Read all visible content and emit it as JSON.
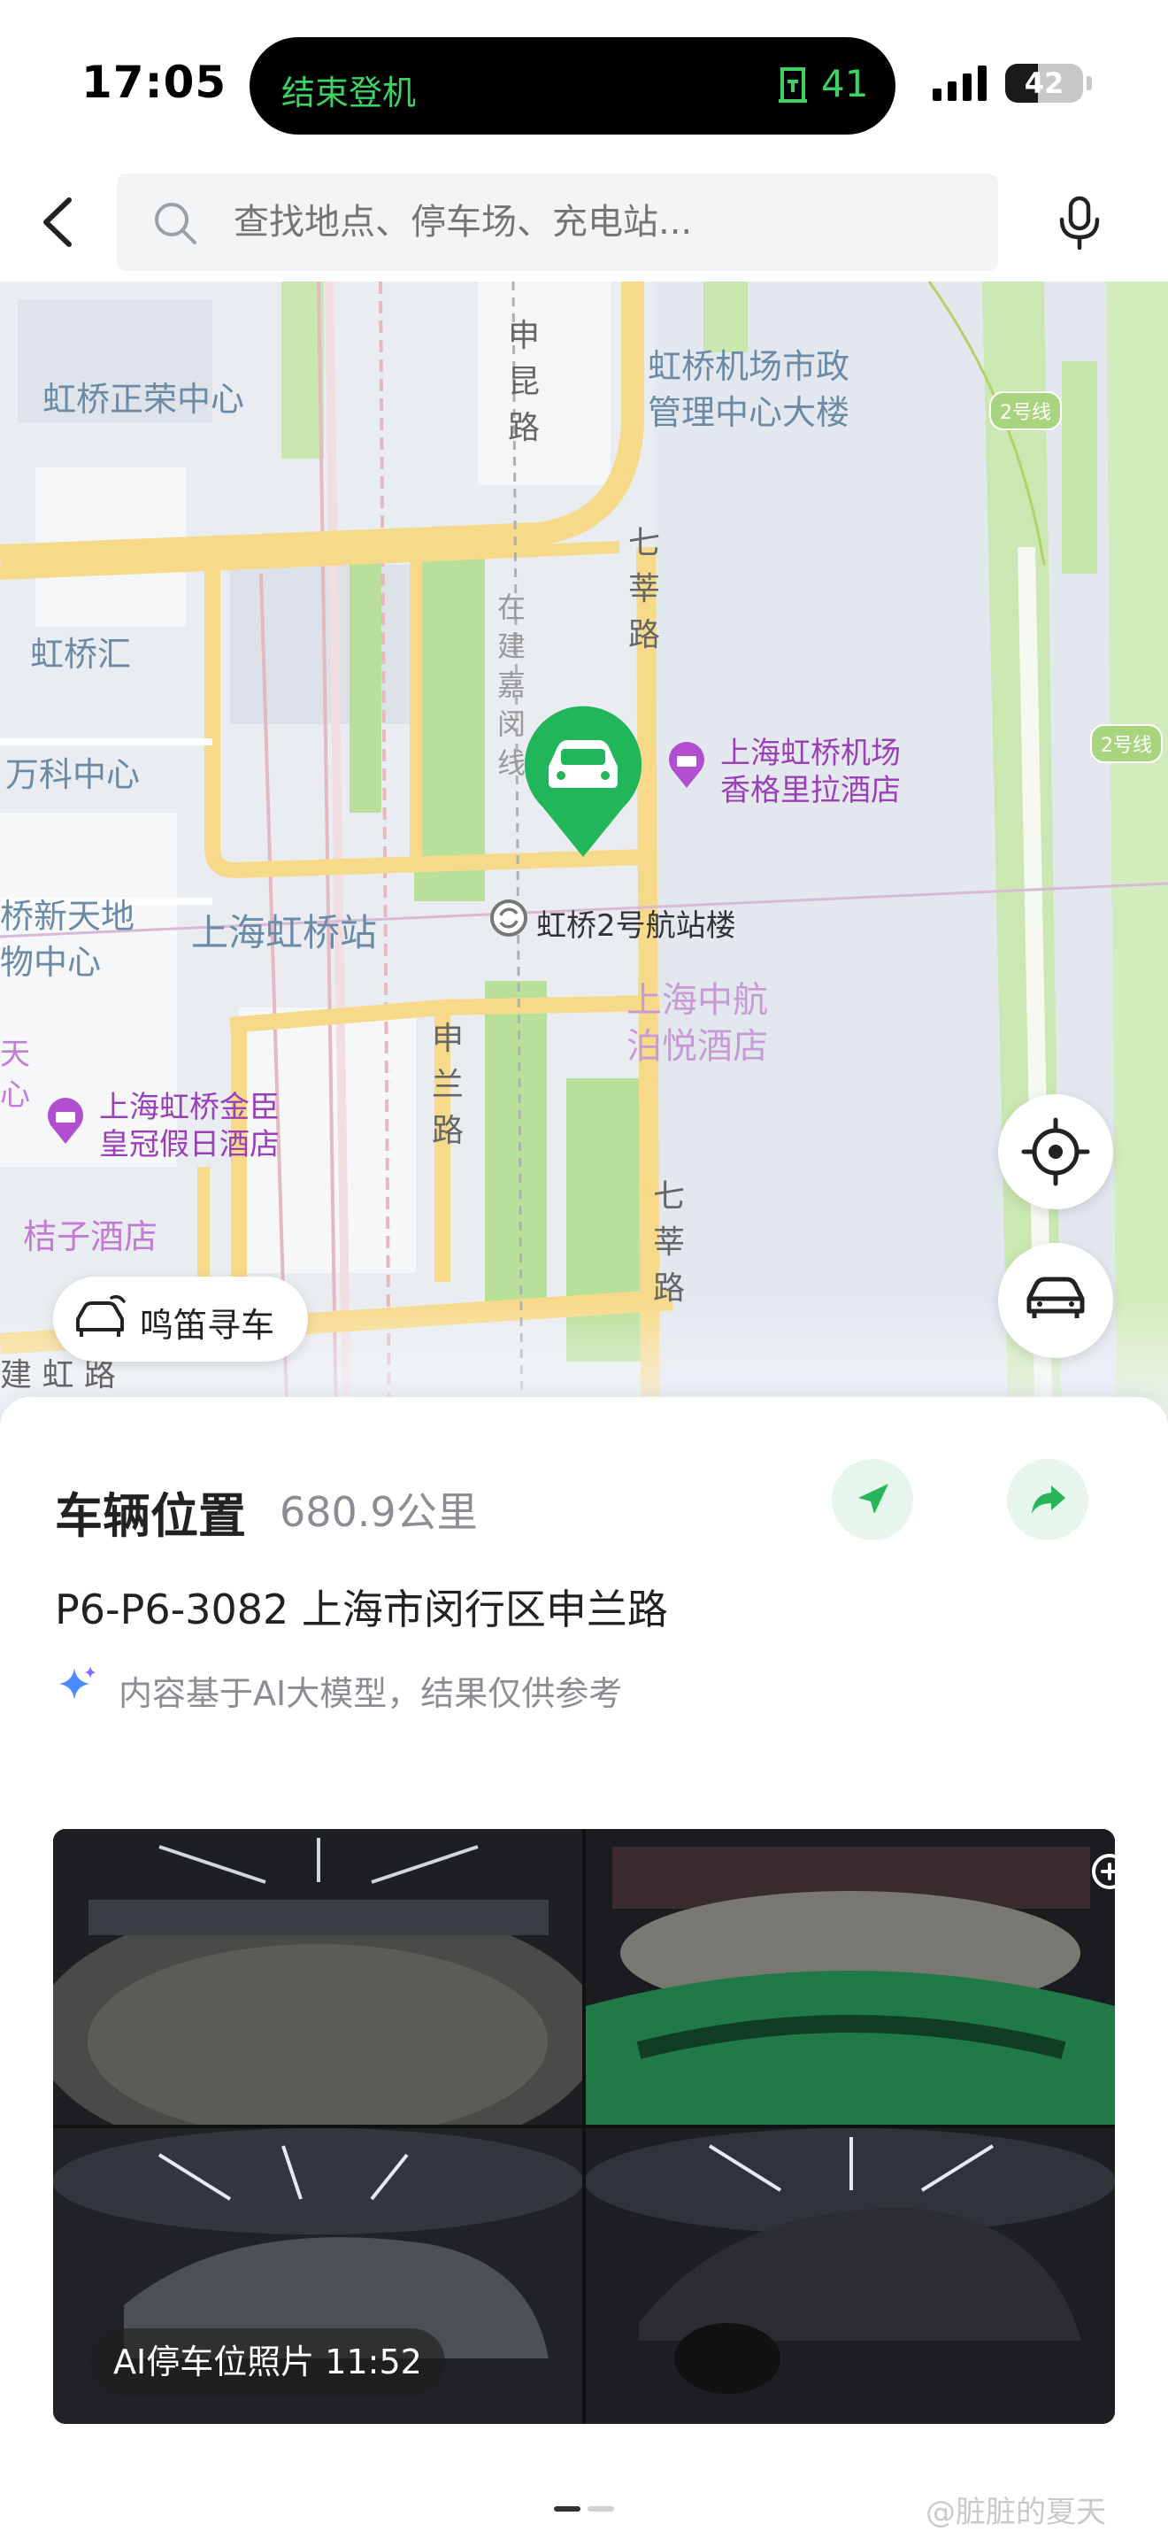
{
  "status_bar": {
    "time": "17:05",
    "island_label": "结束登机",
    "island_gate": "41",
    "battery": "42",
    "battery_level": 0.42,
    "accent_color": "#3ed264"
  },
  "search": {
    "placeholder": "查找地点、停车场、充电站..."
  },
  "map": {
    "labels": {
      "hongqiao_zhengrong": "虹桥正荣中心",
      "shenkun_road": "申昆路",
      "airport_admin": "虹桥机场市政\n管理中心大楼",
      "qixin_road_north": "七莘路",
      "hongqiao_hui": "虹桥汇",
      "vanke_center": "万科中心",
      "under_construction_line": "在建嘉闵线",
      "shangri_la": "上海虹桥机场\n香格里拉酒店",
      "tiandi_1": "桥新天地",
      "tiandi_2": "物中心",
      "hongqiao_station": "上海虹桥站",
      "terminal_2": "虹桥2号航站楼",
      "avic_hotel": "上海中航\n泊悦酒店",
      "shenlan_road": "申兰路",
      "crowne_plaza": "上海虹桥金臣\n皇冠假日酒店",
      "tian_xin": "天\n心",
      "orange_hotel": "桔子酒店",
      "qixin_road_south": "七莘路",
      "bottom_road": "建 虹 路",
      "line2_a": "2号线",
      "line2_b": "2号线"
    },
    "honk_label": "鸣笛寻车"
  },
  "panel": {
    "title": "车辆位置",
    "distance": "680.9公里",
    "address": "P6-P6-3082 上海市闵行区申兰路",
    "ai_note": "内容基于AI大模型，结果仅供参考",
    "photo_caption": "AI停车位照片 11:52",
    "accent_color": "#27b45a"
  },
  "watermark": "@脏脏的夏天"
}
